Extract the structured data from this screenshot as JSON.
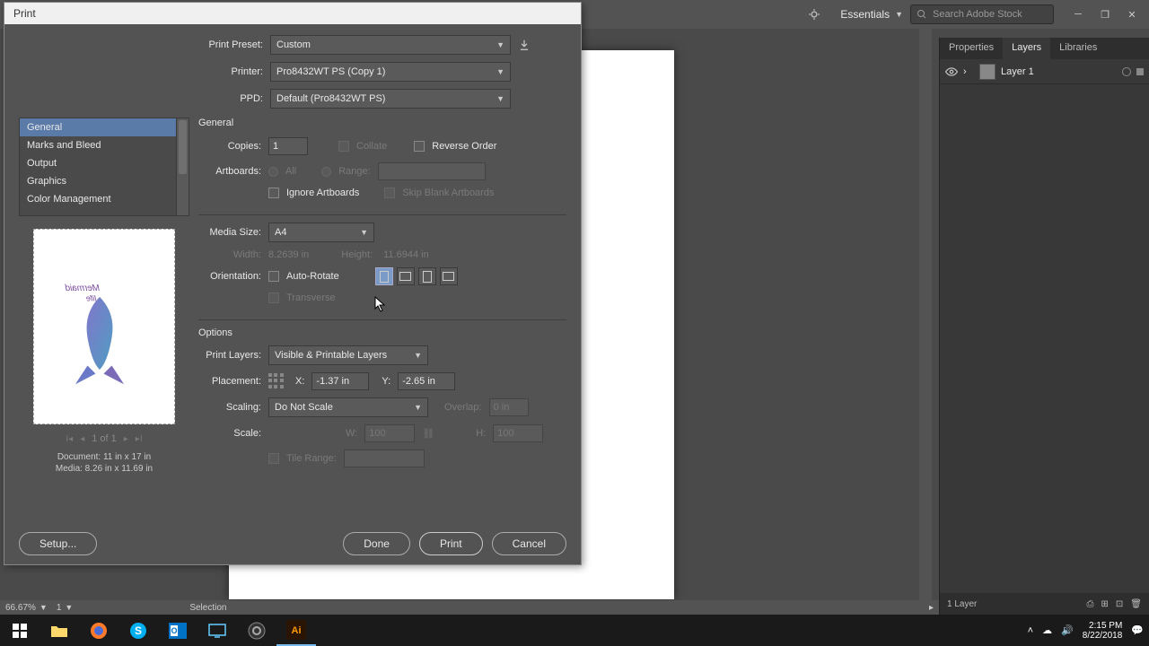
{
  "app_bar": {
    "workspace": "Essentials",
    "search_placeholder": "Search Adobe Stock"
  },
  "dialog": {
    "title": "Print",
    "labels": {
      "print_preset": "Print Preset:",
      "printer": "Printer:",
      "ppd": "PPD:",
      "copies": "Copies:",
      "collate": "Collate",
      "reverse_order": "Reverse Order",
      "artboards": "Artboards:",
      "all": "All",
      "range": "Range:",
      "ignore_artboards": "Ignore Artboards",
      "skip_blank": "Skip Blank Artboards",
      "media_size": "Media Size:",
      "width": "Width:",
      "height": "Height:",
      "orientation": "Orientation:",
      "auto_rotate": "Auto-Rotate",
      "transverse": "Transverse",
      "options": "Options",
      "general": "General",
      "print_layers": "Print Layers:",
      "placement": "Placement:",
      "x": "X:",
      "y": "Y:",
      "scaling": "Scaling:",
      "overlap": "Overlap:",
      "scale": "Scale:",
      "w": "W:",
      "h": "H:",
      "tile_range": "Tile Range:"
    },
    "values": {
      "print_preset": "Custom",
      "printer": "Pro8432WT PS (Copy 1)",
      "ppd": "Default (Pro8432WT PS)",
      "copies": "1",
      "media_size": "A4",
      "width": "8.2639 in",
      "height": "11.6944 in",
      "print_layers": "Visible & Printable Layers",
      "x": "-1.37 in",
      "y": "-2.65 in",
      "scaling": "Do Not Scale",
      "overlap": "0 in",
      "w": "100",
      "h": "100"
    },
    "nav": [
      "General",
      "Marks and Bleed",
      "Output",
      "Graphics",
      "Color Management"
    ],
    "page_indicator": "1 of 1",
    "doc_line": "Document: 11 in x 17 in",
    "media_line": "Media: 8.26 in x 11.69 in",
    "buttons": {
      "setup": "Setup...",
      "done": "Done",
      "print": "Print",
      "cancel": "Cancel"
    }
  },
  "panels": {
    "tabs": [
      "Properties",
      "Layers",
      "Libraries"
    ],
    "layer_name": "Layer 1",
    "footer": "1 Layer"
  },
  "statusbar": {
    "zoom": "66.67%",
    "artboard_num": "1",
    "tool": "Selection"
  },
  "tray": {
    "time": "2:15 PM",
    "date": "8/22/2018"
  }
}
